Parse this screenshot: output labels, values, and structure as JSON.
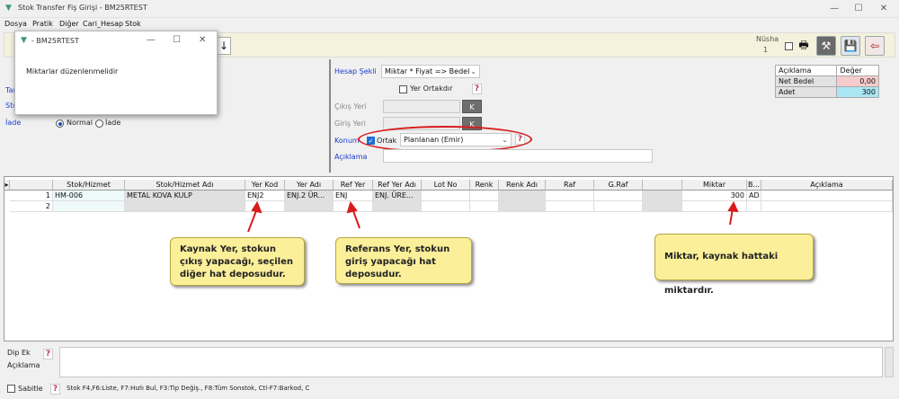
{
  "window": {
    "title": "Stok Transfer Fiş Girişi - BM25RTEST",
    "minimize": "—",
    "maximize": "☐",
    "close": "✕"
  },
  "menu": [
    "Dosya",
    "Pratik",
    "Diğer",
    "Cari_Hesap",
    "Stok"
  ],
  "toolbar": {
    "nusha_label": "Nüsha",
    "nusha_value": "1"
  },
  "left_panel": {
    "row1_label": "Tar",
    "row2_label": "Sto",
    "iade_label": "İade",
    "radio_normal": "Normal",
    "radio_iade": "İade"
  },
  "mid_panel": {
    "hesap_sekli_label": "Hesap Şekli",
    "hesap_sekli_value": "Miktar * Fiyat => Bedel",
    "yer_ortakdir_label": "Yer Ortakdır",
    "cikis_yeri_label": "Çıkış Yeri",
    "giris_yeri_label": "Giriş Yeri",
    "k_button": "K",
    "konum_label": "Konum",
    "ortak_label": "Ortak",
    "konum_value": "Planlanan (Emir)",
    "aciklama_label": "Açıklama",
    "help": "?"
  },
  "summary": {
    "headers": [
      "Açıklama",
      "Değer"
    ],
    "rows": [
      {
        "label": "Net Bedel",
        "value": "0,00"
      },
      {
        "label": "Adet",
        "value": "300"
      }
    ]
  },
  "grid": {
    "headers": [
      "Stok/Hizmet",
      "Stok/Hizmet Adı",
      "Yer Kod",
      "Yer Adı",
      "Ref Yer",
      "Ref Yer Adı",
      "Lot No",
      "Renk",
      "Renk Adı",
      "Raf",
      "G.Raf",
      "",
      "Miktar",
      "B...",
      "Açıklama"
    ],
    "rows": [
      {
        "num": "1",
        "stok": "HM-006",
        "adi": "METAL KOVA KULP",
        "yer_kod": "ENJ2",
        "yer_adi": "ENJ.2 ÜR...",
        "ref_yer": "ENJ",
        "ref_yer_adi": "ENJ. ÜRE...",
        "miktar": "300",
        "birim": "AD"
      },
      {
        "num": "2",
        "stok": "",
        "adi": "",
        "yer_kod": "",
        "yer_adi": "",
        "ref_yer": "",
        "ref_yer_adi": "",
        "miktar": "",
        "birim": ""
      }
    ]
  },
  "callouts": {
    "kaynak": "Kaynak Yer, stokun çıkış yapacağı, seçilen diğer hat deposudur.",
    "referans": "Referans Yer, stokun giriş yapacağı hat deposudur.",
    "miktar": "Miktar, kaynak hattaki miktardır."
  },
  "dip": {
    "label1": "Dip Ek",
    "label2": "Açıklama"
  },
  "status": {
    "sabitle": "Sabitle",
    "shortcuts": "Stok F4,F6:Liste, F7:Hızlı Bul, F3:Tip Değiş., F8:Tüm Sonstok, Ctl-F7:Barkod, C"
  },
  "dialog": {
    "title": "- BM25RTEST",
    "message": "Miktarlar düzenlenmelidir"
  },
  "colors": {
    "callout_bg": "#fbef9a",
    "annotation_red": "#d81b1b",
    "net_bedel_bg": "#f6cccc",
    "adet_bg": "#a9e6f4"
  }
}
